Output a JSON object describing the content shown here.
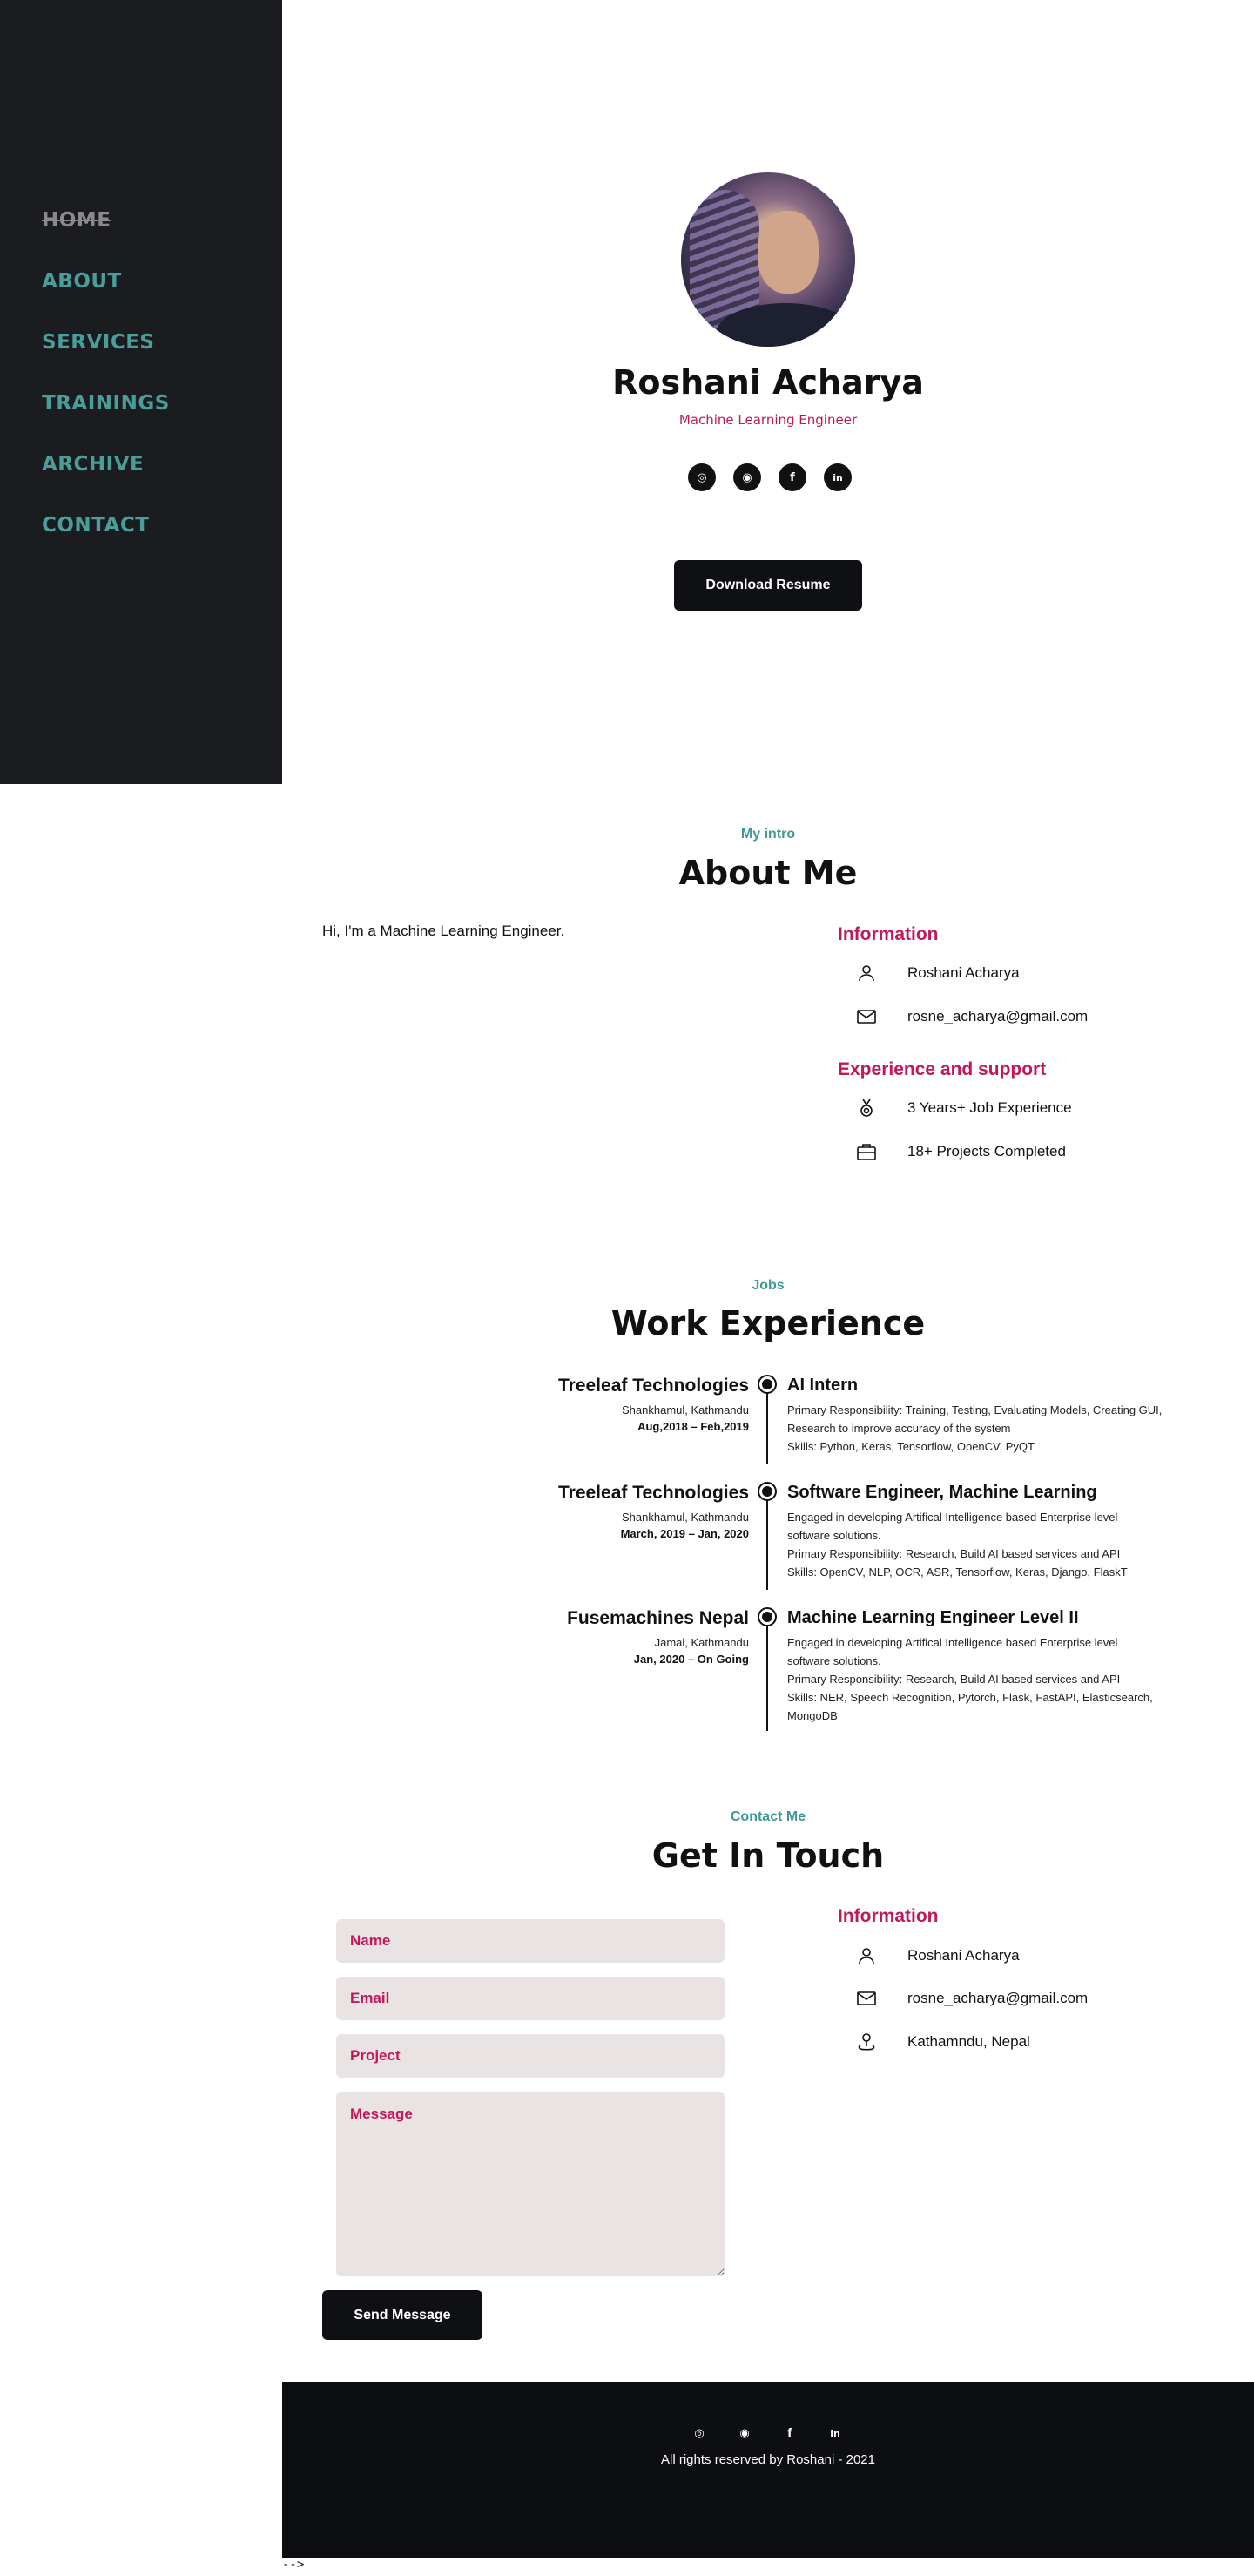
{
  "nav": {
    "items": [
      {
        "label": "HOME",
        "active": true
      },
      {
        "label": "ABOUT"
      },
      {
        "label": "SERVICES"
      },
      {
        "label": "TRAININGS"
      },
      {
        "label": "ARCHIVE"
      },
      {
        "label": "CONTACT"
      }
    ]
  },
  "hero": {
    "name": "Roshani Acharya",
    "role": "Machine Learning Engineer",
    "socials": [
      {
        "icon": "instagram-icon",
        "glyph": "◎"
      },
      {
        "icon": "github-icon",
        "glyph": "◉"
      },
      {
        "icon": "facebook-icon",
        "glyph": "f"
      },
      {
        "icon": "linkedin-icon",
        "glyph": "in"
      }
    ],
    "resume_label": "Download Resume"
  },
  "about": {
    "subtitle": "My intro",
    "title": "About Me",
    "intro": "Hi, I'm a Machine Learning Engineer.",
    "info_heading": "Information",
    "name": "Roshani Acharya",
    "email": "rosne_acharya@gmail.com",
    "exp_heading": "Experience and support",
    "experience": "3 Years+ Job Experience",
    "projects": "18+ Projects Completed"
  },
  "work": {
    "subtitle": "Jobs",
    "title": "Work Experience",
    "jobs": [
      {
        "company": "Treeleaf Technologies",
        "location": "Shankhamul, Kathmandu",
        "dates": "Aug,2018 – Feb,2019",
        "title": "AI Intern",
        "lines": [
          "Primary Responsibility: Training, Testing, Evaluating Models, Creating GUI,",
          "Research to improve accuracy of the system",
          "Skills: Python, Keras, Tensorflow, OpenCV, PyQT"
        ]
      },
      {
        "company": "Treeleaf Technologies",
        "location": "Shankhamul, Kathmandu",
        "dates": "March, 2019 – Jan, 2020",
        "title": "Software Engineer, Machine Learning",
        "lines": [
          "Engaged in developing Artifical Intelligence based Enterprise level",
          "software solutions.",
          "Primary Responsibility: Research, Build AI based services and API",
          "Skills: OpenCV, NLP, OCR, ASR, Tensorflow, Keras, Django, FlaskT"
        ]
      },
      {
        "company": "Fusemachines Nepal",
        "location": "Jamal, Kathmandu",
        "dates": "Jan, 2020 – On Going",
        "title": "Machine Learning Engineer Level II",
        "lines": [
          "Engaged in developing Artifical Intelligence based Enterprise level",
          "software solutions.",
          "Primary Responsibility: Research, Build AI based services and API",
          "Skills: NER, Speech Recognition, Pytorch, Flask, FastAPI, Elasticsearch,",
          "MongoDB"
        ]
      }
    ]
  },
  "contact": {
    "subtitle": "Contact Me",
    "title": "Get In Touch",
    "placeholders": {
      "name": "Name",
      "email": "Email",
      "project": "Project",
      "message": "Message"
    },
    "send_label": "Send Message",
    "info_heading": "Information",
    "name": "Roshani Acharya",
    "email": "rosne_acharya@gmail.com",
    "location": "Kathamndu, Nepal"
  },
  "footer": {
    "text": "All rights reserved by Roshani - 2021"
  },
  "stray_text": "-->"
}
